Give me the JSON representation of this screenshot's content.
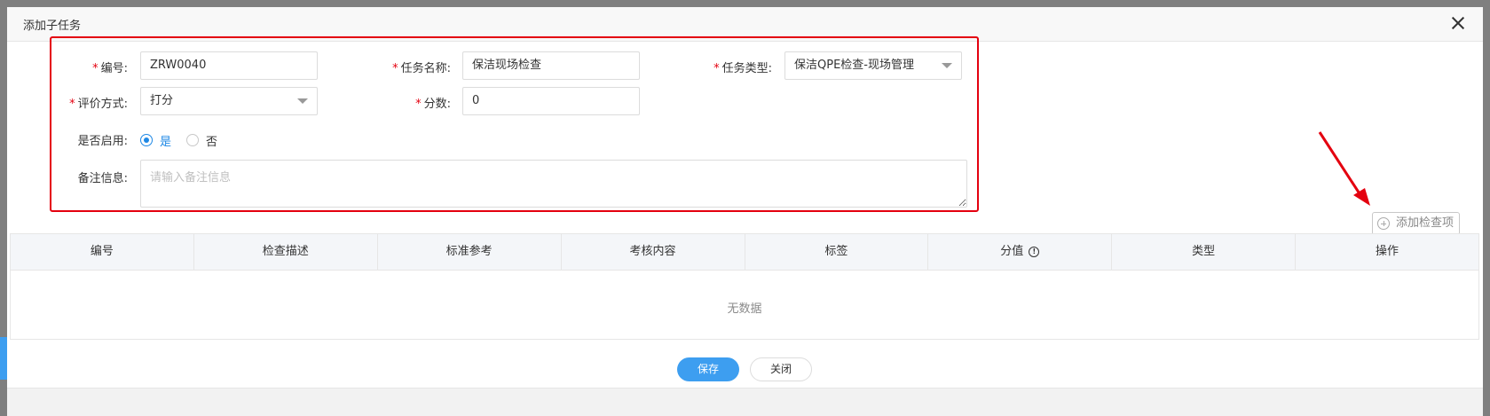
{
  "modal": {
    "title": "添加子任务"
  },
  "form": {
    "required_mark": "*",
    "code": {
      "label": "编号:",
      "value": "ZRW0040"
    },
    "task_name": {
      "label": "任务名称:",
      "value": "保洁现场检查"
    },
    "task_type": {
      "label": "任务类型:",
      "value": "保洁QPE检查-现场管理"
    },
    "eval_method": {
      "label": "评价方式:",
      "value": "打分"
    },
    "score": {
      "label": "分数:",
      "value": "0"
    },
    "enabled": {
      "label": "是否启用:",
      "option_yes": "是",
      "option_no": "否",
      "selected": "是"
    },
    "note": {
      "label": "备注信息:",
      "placeholder": "请输入备注信息"
    }
  },
  "add_item_button": "添加检查项",
  "table": {
    "columns": [
      "编号",
      "检查描述",
      "标准参考",
      "考核内容",
      "标签",
      "分值",
      "类型",
      "操作"
    ],
    "empty_text": "无数据"
  },
  "footer": {
    "save_label": "保存",
    "close_label": "关闭"
  },
  "colors": {
    "highlight": "#e4000f",
    "primary": "#3d9ef0"
  }
}
